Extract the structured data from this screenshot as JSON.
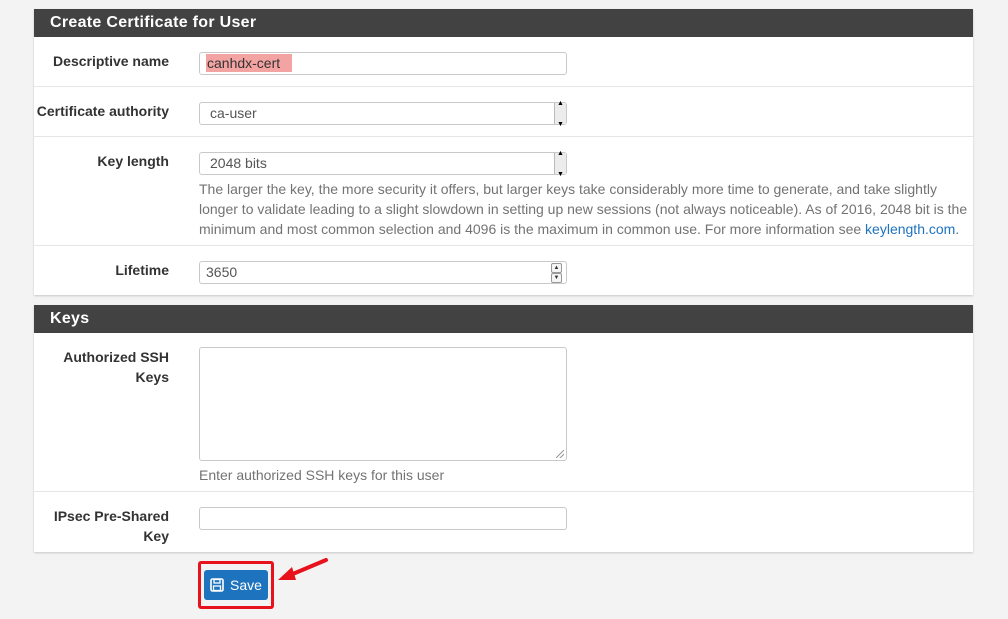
{
  "cert_panel": {
    "title": "Create Certificate for User",
    "descriptive_name": {
      "label": "Descriptive name",
      "value": "canhdx-cert"
    },
    "certificate_authority": {
      "label": "Certificate authority",
      "value": "ca-user"
    },
    "key_length": {
      "label": "Key length",
      "value": "2048 bits",
      "help_text": "The larger the key, the more security it offers, but larger keys take considerably more time to generate, and take slightly longer to validate leading to a slight slowdown in setting up new sessions (not always noticeable). As of 2016, 2048 bit is the minimum and most common selection and 4096 is the maximum in common use. For more information see ",
      "help_link": "keylength.com",
      "help_end": "."
    },
    "lifetime": {
      "label": "Lifetime",
      "value": "3650"
    }
  },
  "keys_panel": {
    "title": "Keys",
    "ssh_keys": {
      "label_line1": "Authorized SSH",
      "label_line2": "Keys",
      "value": "",
      "help_text": "Enter authorized SSH keys for this user"
    },
    "ipsec": {
      "label_line1": "IPsec Pre-Shared",
      "label_line2": "Key",
      "value": ""
    }
  },
  "save_button": {
    "label": "Save",
    "icon": "floppy-disk-icon"
  },
  "colors": {
    "header": "#424242",
    "primary": "#1e73be",
    "annotation": "#e8121c",
    "highlight": "#f4a3a3"
  }
}
